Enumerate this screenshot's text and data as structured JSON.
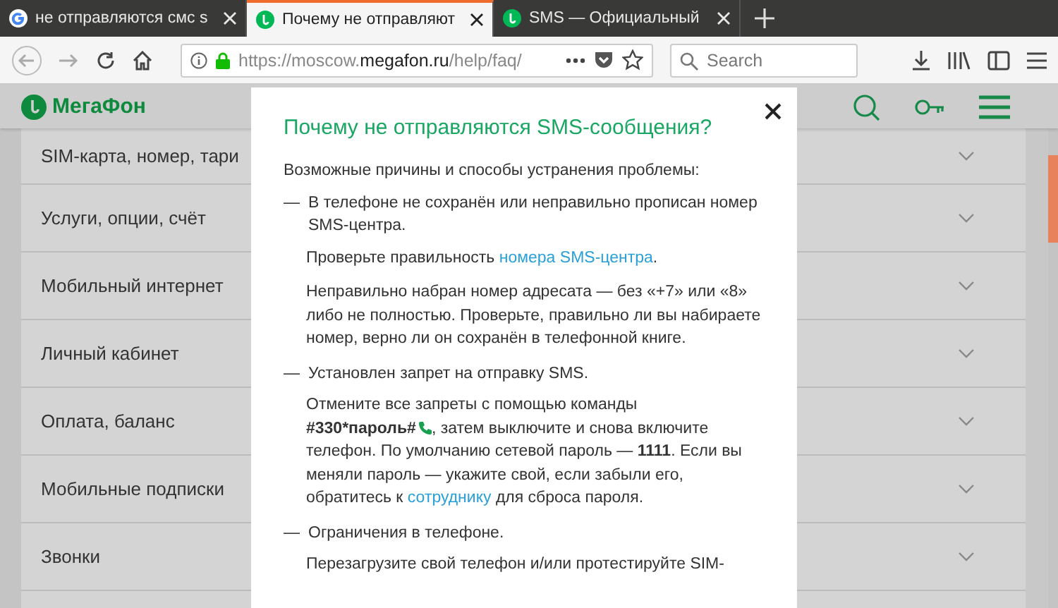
{
  "browser": {
    "tabs": [
      {
        "title": "не отправляются смс s",
        "kind": "google",
        "selected": false
      },
      {
        "title": "Почему не отправляют",
        "kind": "megafon",
        "selected": true
      },
      {
        "title": "SMS — Официальный",
        "kind": "megafon",
        "selected": false
      }
    ],
    "url": {
      "prefix": "https://moscow.",
      "domain": "megafon.ru",
      "path": "/help/faq/"
    },
    "search": {
      "placeholder": "Search"
    }
  },
  "site": {
    "logo": "МегаФон",
    "sections": [
      {
        "label": "SIM-карта, номер, тари"
      },
      {
        "label": "Услуги, опции, счёт"
      },
      {
        "label": "Мобильный интернет"
      },
      {
        "label": "Личный кабинет"
      },
      {
        "label": "Оплата, баланс"
      },
      {
        "label": "Мобильные подписки"
      },
      {
        "label": "Звонки"
      }
    ]
  },
  "modal": {
    "title": "Почему не отправляются SMS-сообщения?",
    "intro": "Возможные причины и способы устранения проблемы:",
    "items": [
      {
        "marker": "—",
        "heading": "В телефоне не сохранён или неправильно прописан номер SMS-центра.",
        "paragraphs": [
          [
            {
              "kind": "text",
              "text": "Проверьте правильность "
            },
            {
              "kind": "link",
              "text": "номера SMS-центра"
            },
            {
              "kind": "text",
              "text": "."
            }
          ],
          [
            {
              "kind": "text",
              "text": "Неправильно набран номер адресата — без «+7» или «8» либо не полностью. Проверьте, правильно ли вы набираете номер, верно ли он сохранён в телефонной книге."
            }
          ]
        ]
      },
      {
        "marker": "—",
        "heading": "Установлен запрет на отправку SMS.",
        "paragraphs": [
          [
            {
              "kind": "text",
              "text": "Отмените все запреты с помощью команды "
            },
            {
              "kind": "code",
              "text": "#330*пароль#",
              "call_icon": true
            },
            {
              "kind": "text",
              "text": ", затем выключите и снова включите телефон. По умолчанию сетевой пароль — "
            },
            {
              "kind": "bold",
              "text": "1111"
            },
            {
              "kind": "text",
              "text": ". Если вы меняли пароль — укажите свой, если забыли его, обратитесь к "
            },
            {
              "kind": "link",
              "text": "сотруднику"
            },
            {
              "kind": "text",
              "text": " для сброса пароля."
            }
          ]
        ]
      },
      {
        "marker": "—",
        "heading": "Ограничения в телефоне.",
        "paragraphs": [
          [
            {
              "kind": "text",
              "text": "Перезагрузите свой телефон и/или протестируйте SIM-"
            }
          ]
        ]
      }
    ]
  }
}
